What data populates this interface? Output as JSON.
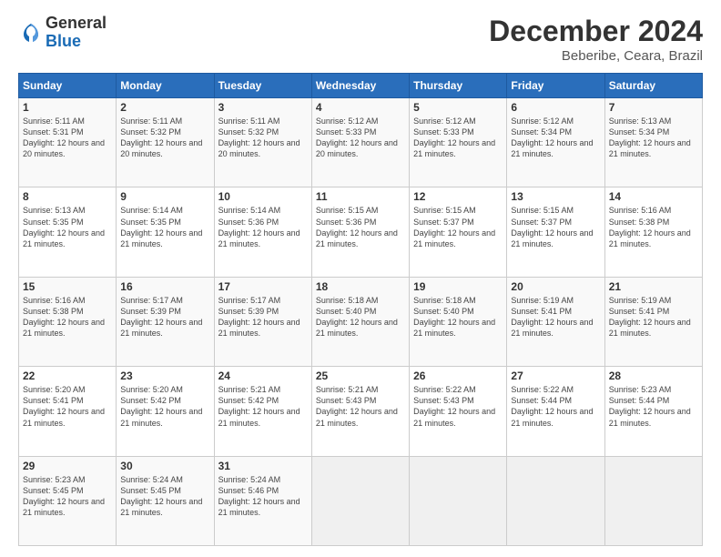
{
  "header": {
    "logo_general": "General",
    "logo_blue": "Blue",
    "title": "December 2024",
    "subtitle": "Beberibe, Ceara, Brazil"
  },
  "days_of_week": [
    "Sunday",
    "Monday",
    "Tuesday",
    "Wednesday",
    "Thursday",
    "Friday",
    "Saturday"
  ],
  "weeks": [
    [
      {
        "day": "1",
        "sunrise": "5:11 AM",
        "sunset": "5:31 PM",
        "daylight": "12 hours and 20 minutes."
      },
      {
        "day": "2",
        "sunrise": "5:11 AM",
        "sunset": "5:32 PM",
        "daylight": "12 hours and 20 minutes."
      },
      {
        "day": "3",
        "sunrise": "5:11 AM",
        "sunset": "5:32 PM",
        "daylight": "12 hours and 20 minutes."
      },
      {
        "day": "4",
        "sunrise": "5:12 AM",
        "sunset": "5:33 PM",
        "daylight": "12 hours and 20 minutes."
      },
      {
        "day": "5",
        "sunrise": "5:12 AM",
        "sunset": "5:33 PM",
        "daylight": "12 hours and 21 minutes."
      },
      {
        "day": "6",
        "sunrise": "5:12 AM",
        "sunset": "5:34 PM",
        "daylight": "12 hours and 21 minutes."
      },
      {
        "day": "7",
        "sunrise": "5:13 AM",
        "sunset": "5:34 PM",
        "daylight": "12 hours and 21 minutes."
      }
    ],
    [
      {
        "day": "8",
        "sunrise": "5:13 AM",
        "sunset": "5:35 PM",
        "daylight": "12 hours and 21 minutes."
      },
      {
        "day": "9",
        "sunrise": "5:14 AM",
        "sunset": "5:35 PM",
        "daylight": "12 hours and 21 minutes."
      },
      {
        "day": "10",
        "sunrise": "5:14 AM",
        "sunset": "5:36 PM",
        "daylight": "12 hours and 21 minutes."
      },
      {
        "day": "11",
        "sunrise": "5:15 AM",
        "sunset": "5:36 PM",
        "daylight": "12 hours and 21 minutes."
      },
      {
        "day": "12",
        "sunrise": "5:15 AM",
        "sunset": "5:37 PM",
        "daylight": "12 hours and 21 minutes."
      },
      {
        "day": "13",
        "sunrise": "5:15 AM",
        "sunset": "5:37 PM",
        "daylight": "12 hours and 21 minutes."
      },
      {
        "day": "14",
        "sunrise": "5:16 AM",
        "sunset": "5:38 PM",
        "daylight": "12 hours and 21 minutes."
      }
    ],
    [
      {
        "day": "15",
        "sunrise": "5:16 AM",
        "sunset": "5:38 PM",
        "daylight": "12 hours and 21 minutes."
      },
      {
        "day": "16",
        "sunrise": "5:17 AM",
        "sunset": "5:39 PM",
        "daylight": "12 hours and 21 minutes."
      },
      {
        "day": "17",
        "sunrise": "5:17 AM",
        "sunset": "5:39 PM",
        "daylight": "12 hours and 21 minutes."
      },
      {
        "day": "18",
        "sunrise": "5:18 AM",
        "sunset": "5:40 PM",
        "daylight": "12 hours and 21 minutes."
      },
      {
        "day": "19",
        "sunrise": "5:18 AM",
        "sunset": "5:40 PM",
        "daylight": "12 hours and 21 minutes."
      },
      {
        "day": "20",
        "sunrise": "5:19 AM",
        "sunset": "5:41 PM",
        "daylight": "12 hours and 21 minutes."
      },
      {
        "day": "21",
        "sunrise": "5:19 AM",
        "sunset": "5:41 PM",
        "daylight": "12 hours and 21 minutes."
      }
    ],
    [
      {
        "day": "22",
        "sunrise": "5:20 AM",
        "sunset": "5:41 PM",
        "daylight": "12 hours and 21 minutes."
      },
      {
        "day": "23",
        "sunrise": "5:20 AM",
        "sunset": "5:42 PM",
        "daylight": "12 hours and 21 minutes."
      },
      {
        "day": "24",
        "sunrise": "5:21 AM",
        "sunset": "5:42 PM",
        "daylight": "12 hours and 21 minutes."
      },
      {
        "day": "25",
        "sunrise": "5:21 AM",
        "sunset": "5:43 PM",
        "daylight": "12 hours and 21 minutes."
      },
      {
        "day": "26",
        "sunrise": "5:22 AM",
        "sunset": "5:43 PM",
        "daylight": "12 hours and 21 minutes."
      },
      {
        "day": "27",
        "sunrise": "5:22 AM",
        "sunset": "5:44 PM",
        "daylight": "12 hours and 21 minutes."
      },
      {
        "day": "28",
        "sunrise": "5:23 AM",
        "sunset": "5:44 PM",
        "daylight": "12 hours and 21 minutes."
      }
    ],
    [
      {
        "day": "29",
        "sunrise": "5:23 AM",
        "sunset": "5:45 PM",
        "daylight": "12 hours and 21 minutes."
      },
      {
        "day": "30",
        "sunrise": "5:24 AM",
        "sunset": "5:45 PM",
        "daylight": "12 hours and 21 minutes."
      },
      {
        "day": "31",
        "sunrise": "5:24 AM",
        "sunset": "5:46 PM",
        "daylight": "12 hours and 21 minutes."
      },
      null,
      null,
      null,
      null
    ]
  ]
}
